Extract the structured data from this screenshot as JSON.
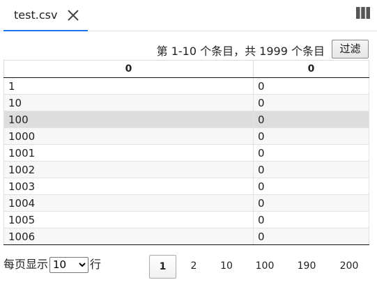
{
  "tab": {
    "label": "test.csv"
  },
  "info_text": "第 1-10 个条目，共 1999 个条目",
  "filter_label": "过滤",
  "table": {
    "headers": [
      "0",
      "0"
    ],
    "rows": [
      [
        "1",
        "0"
      ],
      [
        "10",
        "0"
      ],
      [
        "100",
        "0"
      ],
      [
        "1000",
        "0"
      ],
      [
        "1001",
        "0"
      ],
      [
        "1002",
        "0"
      ],
      [
        "1003",
        "0"
      ],
      [
        "1004",
        "0"
      ],
      [
        "1005",
        "0"
      ],
      [
        "1006",
        "0"
      ]
    ]
  },
  "page_length": {
    "prefix": "每页显示",
    "selected": "10",
    "suffix": "行"
  },
  "pagination": {
    "pages": [
      "1",
      "2",
      "10",
      "100",
      "190",
      "200"
    ],
    "current": "1"
  },
  "icons": {
    "close": "close-icon",
    "columns": "columns-icon"
  },
  "colors": {
    "accent": "#1a73e8",
    "hover_row": "#dddddd"
  }
}
